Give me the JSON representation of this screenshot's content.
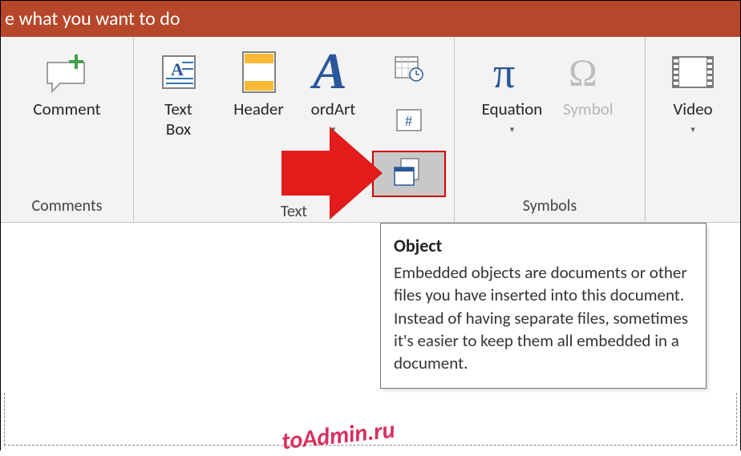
{
  "title_hint": "e what you want to do",
  "groups": {
    "comments": {
      "label": "Comments",
      "comment": "Comment"
    },
    "text": {
      "label": "Text",
      "text_box": "Text\nBox",
      "header": "Header",
      "wordart": "ordArt",
      "date_time": "Date & Time",
      "slide_number": "Slide Number",
      "object": "Object"
    },
    "symbols": {
      "label": "Symbols",
      "equation": "Equation",
      "symbol": "Symbol"
    },
    "media": {
      "video": "Video"
    }
  },
  "tooltip": {
    "title": "Object",
    "body": "Embedded objects are documents or other files you have inserted into this document. Instead of having separate files, sometimes it's easier to keep them all embedded in a document."
  },
  "watermark": "toAdmin.ru"
}
